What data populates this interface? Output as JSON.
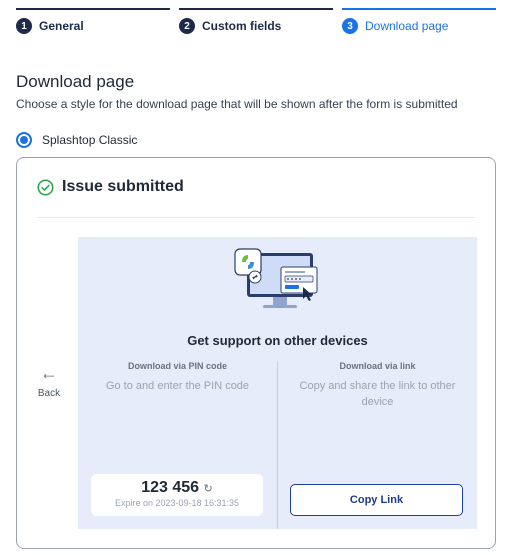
{
  "stepper": {
    "steps": [
      {
        "num": "1",
        "label": "General"
      },
      {
        "num": "2",
        "label": "Custom fields"
      },
      {
        "num": "3",
        "label": "Download page"
      }
    ]
  },
  "main": {
    "title": "Download page",
    "description": "Choose a style for the download page that will be shown after the form is submitted"
  },
  "style_option": {
    "label": "Splashtop Classic",
    "selected": true
  },
  "preview": {
    "issue_title": "Issue submitted",
    "back_label": "Back",
    "panel_title": "Get support on other devices",
    "pin_column": {
      "title": "Download via PIN code",
      "description": "Go to and enter the PIN code",
      "pin": "123 456",
      "expire": "Expire on 2023-09-18 16:31:35"
    },
    "link_column": {
      "title": "Download via link",
      "description": "Copy and share the link to other device",
      "button_label": "Copy Link"
    }
  },
  "icons": {
    "check": "check-circle-icon",
    "back": "arrow-left-icon",
    "refresh": "refresh-icon"
  },
  "colors": {
    "accent": "#1a73e8",
    "dark_navy": "#1e2a4a",
    "success": "#22a447",
    "panel_bg": "#e6ecfa"
  }
}
